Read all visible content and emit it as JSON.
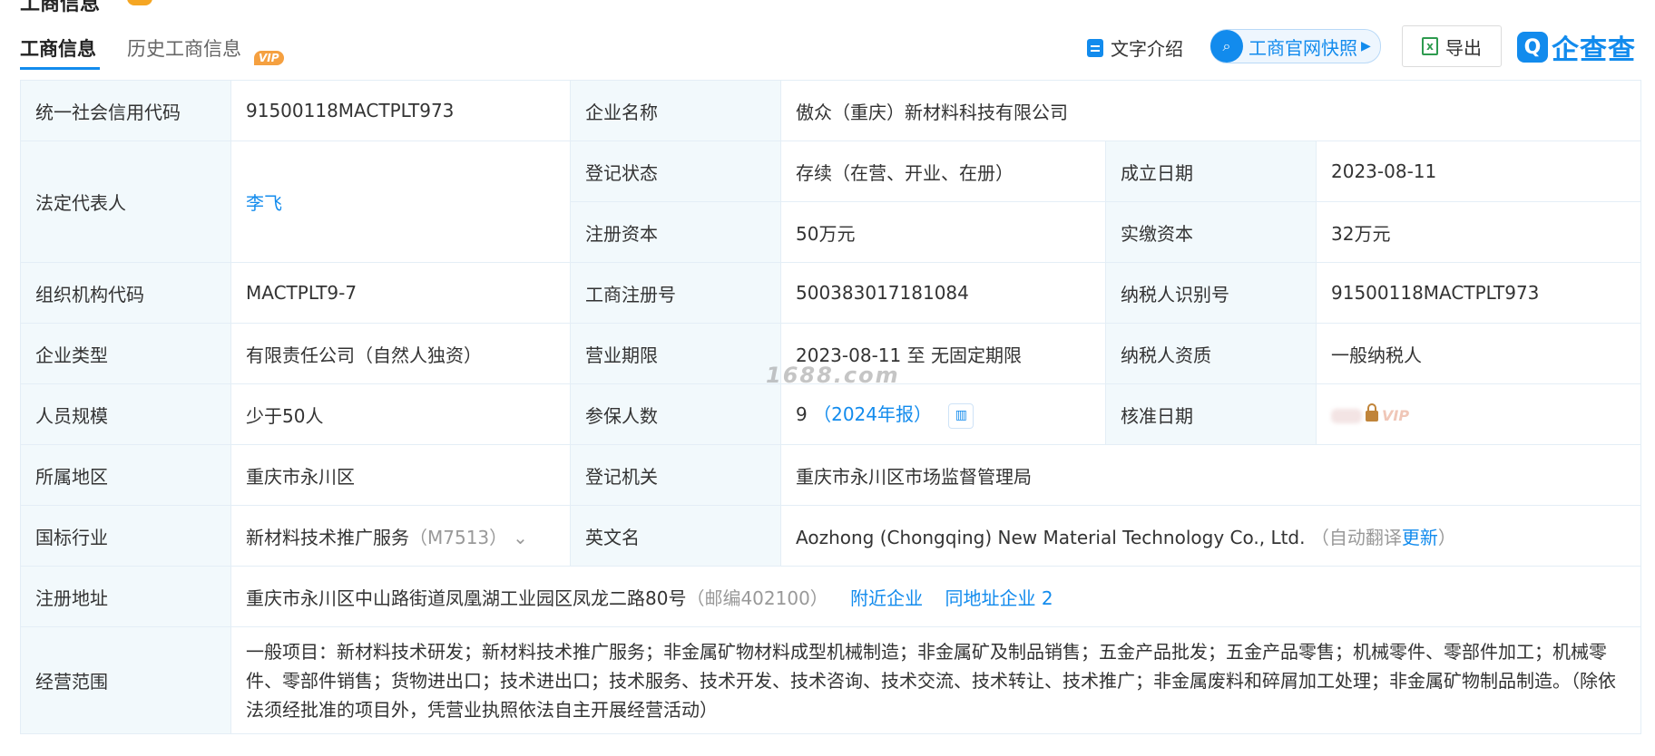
{
  "header": {
    "section_title": "工商信息",
    "tabs": [
      {
        "label": "工商信息",
        "active": true
      },
      {
        "label": "历史工商信息",
        "badge": "VIP"
      }
    ],
    "toolbar": {
      "text_intro": "文字介绍",
      "snapshot": "工商官网快照",
      "export": "导出",
      "logo": "企查查"
    }
  },
  "info": {
    "credit_code": {
      "label": "统一社会信用代码",
      "value": "91500118MACTPLT973"
    },
    "company_name": {
      "label": "企业名称",
      "value": "傲众（重庆）新材料科技有限公司"
    },
    "legal_rep": {
      "label": "法定代表人",
      "value": "李飞"
    },
    "reg_status": {
      "label": "登记状态",
      "value": "存续（在营、开业、在册）"
    },
    "found_date": {
      "label": "成立日期",
      "value": "2023-08-11"
    },
    "reg_capital": {
      "label": "注册资本",
      "value": "50万元"
    },
    "paid_capital": {
      "label": "实缴资本",
      "value": "32万元"
    },
    "org_code": {
      "label": "组织机构代码",
      "value": "MACTPLT9-7"
    },
    "biz_reg_no": {
      "label": "工商注册号",
      "value": "500383017181084"
    },
    "taxpayer_id": {
      "label": "纳税人识别号",
      "value": "91500118MACTPLT973"
    },
    "company_type": {
      "label": "企业类型",
      "value": "有限责任公司（自然人独资）"
    },
    "biz_term": {
      "label": "营业期限",
      "value": "2023-08-11 至 无固定期限"
    },
    "taxpayer_qual": {
      "label": "纳税人资质",
      "value": "一般纳税人"
    },
    "staff_size": {
      "label": "人员规模",
      "value": "少于50人"
    },
    "insured": {
      "label": "参保人数",
      "value": "9",
      "note": "（2024年报）"
    },
    "approve_date": {
      "label": "核准日期",
      "locked_badge": "VIP"
    },
    "region": {
      "label": "所属地区",
      "value": "重庆市永川区"
    },
    "reg_authority": {
      "label": "登记机关",
      "value": "重庆市永川区市场监督管理局"
    },
    "industry": {
      "label": "国标行业",
      "value": "新材料技术推广服务",
      "code": "（M7513）"
    },
    "english_name": {
      "label": "英文名",
      "value": "Aozhong (Chongqing) New Material Technology Co., Ltd.",
      "note": "（自动翻译",
      "update_link": "更新",
      "note_end": "）"
    },
    "address": {
      "label": "注册地址",
      "value": "重庆市永川区中山路街道凤凰湖工业园区凤龙二路80号",
      "postcode": "（邮编402100）",
      "nearby": "附近企业",
      "same_addr": "同地址企业 2"
    },
    "scope": {
      "label": "经营范围",
      "value": "一般项目：新材料技术研发；新材料技术推广服务；非金属矿物材料成型机械制造；非金属矿及制品销售；五金产品批发；五金产品零售；机械零件、零部件加工；机械零件、零部件销售；货物进出口；技术进出口；技术服务、技术开发、技术咨询、技术交流、技术转让、技术推广；非金属废料和碎屑加工处理；非金属矿物制品制造。（除依法须经批准的项目外，凭营业执照依法自主开展经营活动）"
    }
  },
  "watermark": "1688.com",
  "colors": {
    "accent": "#128bed",
    "label_bg": "#f2f9fc",
    "border": "#e4eef6",
    "vip": "#f5a040"
  }
}
